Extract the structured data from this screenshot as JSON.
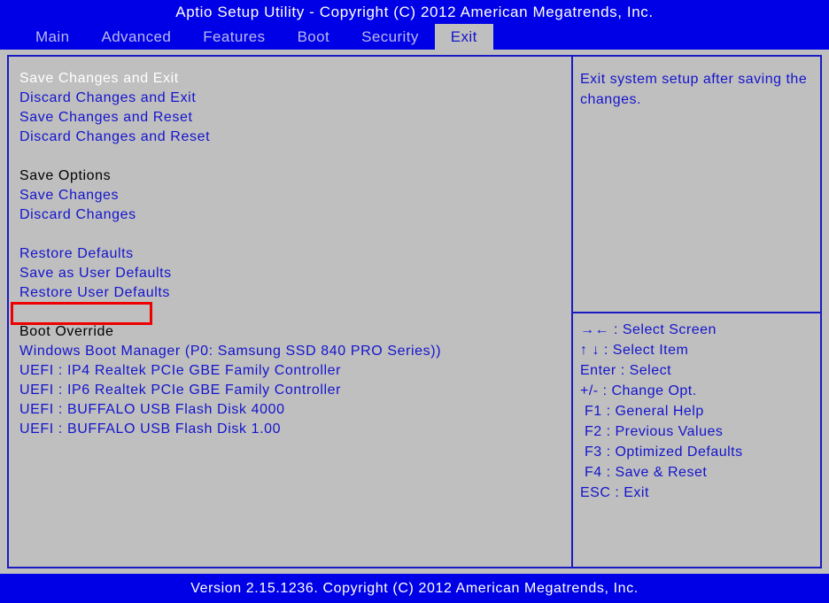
{
  "window": {
    "title": "Aptio Setup Utility - Copyright (C) 2012 American Megatrends, Inc.",
    "footer": "Version 2.15.1236. Copyright (C) 2012 American Megatrends, Inc."
  },
  "colors": {
    "bios_blue": "#0000e6",
    "text_blue": "#1414cd",
    "background_gray": "#bfbfbf",
    "selected_white": "#ffffff",
    "header_black": "#000000",
    "annotation_red": "#ee0000",
    "inactive_tab": "#b9b9ee"
  },
  "menubar": {
    "tabs": [
      {
        "label": "Main",
        "active": false
      },
      {
        "label": "Advanced",
        "active": false
      },
      {
        "label": "Features",
        "active": false
      },
      {
        "label": "Boot",
        "active": false
      },
      {
        "label": "Security",
        "active": false
      },
      {
        "label": "Exit",
        "active": true
      }
    ]
  },
  "main": {
    "options": [
      {
        "label": "Save Changes and Exit",
        "style": "selected"
      },
      {
        "label": "Discard Changes and Exit",
        "style": "normal"
      },
      {
        "label": "Save Changes and Reset",
        "style": "normal"
      },
      {
        "label": "Discard Changes and Reset",
        "style": "normal"
      },
      {
        "label": "",
        "style": "spacer"
      },
      {
        "label": "Save Options",
        "style": "header"
      },
      {
        "label": "Save Changes",
        "style": "normal"
      },
      {
        "label": "Discard Changes",
        "style": "normal"
      },
      {
        "label": "",
        "style": "spacer"
      },
      {
        "label": "Restore Defaults",
        "style": "normal"
      },
      {
        "label": "Save as User Defaults",
        "style": "normal"
      },
      {
        "label": "Restore User Defaults",
        "style": "normal"
      },
      {
        "label": "",
        "style": "spacer"
      },
      {
        "label": "Boot Override",
        "style": "header"
      },
      {
        "label": "Windows Boot Manager (P0: Samsung SSD 840 PRO Series))",
        "style": "normal"
      },
      {
        "label": "UEFI : IP4 Realtek PCIe GBE Family Controller",
        "style": "normal"
      },
      {
        "label": "UEFI : IP6 Realtek PCIe GBE Family Controller",
        "style": "normal"
      },
      {
        "label": "UEFI : BUFFALO USB Flash Disk 4000",
        "style": "normal"
      },
      {
        "label": "UEFI : BUFFALO USB Flash Disk 1.00",
        "style": "normal"
      }
    ]
  },
  "help": {
    "text": "Exit system setup after saving the changes."
  },
  "legend": {
    "rows": [
      "→← : Select Screen",
      "↑ ↓ : Select Item",
      "Enter : Select",
      "+/- : Change Opt.",
      " F1 : General Help",
      " F2 : Previous Values",
      " F3 : Optimized Defaults",
      " F4 : Save & Reset",
      "ESC : Exit"
    ]
  },
  "annotation": {
    "target_label": "Restore Defaults"
  }
}
